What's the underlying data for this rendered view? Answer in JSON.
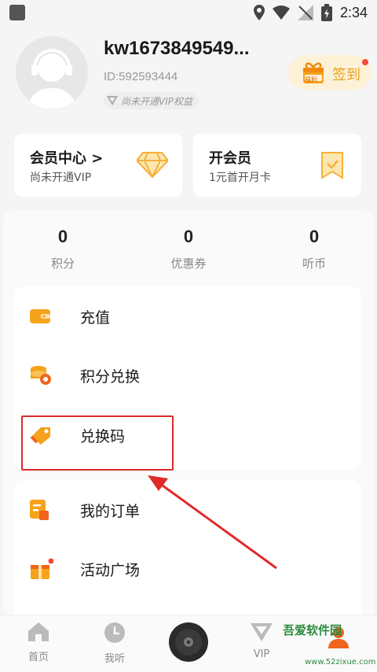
{
  "status_bar": {
    "time": "2:34"
  },
  "profile": {
    "username": "kw1673849549...",
    "user_id": "ID:592593444",
    "vip_status": "尚未开通VIP权益",
    "checkin_label": "签到",
    "checkin_badge": "福利"
  },
  "member_center": {
    "title": "会员中心 >",
    "subtitle": "尚未开通VIP"
  },
  "open_member": {
    "title": "开会员",
    "subtitle": "1元首开月卡"
  },
  "stats": [
    {
      "value": "0",
      "label": "积分"
    },
    {
      "value": "0",
      "label": "优惠券"
    },
    {
      "value": "0",
      "label": "听币"
    }
  ],
  "menu": [
    {
      "label": "充值",
      "icon": "wallet-icon"
    },
    {
      "label": "积分兑换",
      "icon": "coins-icon"
    },
    {
      "label": "兑换码",
      "icon": "tag-icon"
    },
    {
      "label": "我的订单",
      "icon": "order-icon"
    },
    {
      "label": "活动广场",
      "icon": "gift-box-icon"
    }
  ],
  "bottom_nav": [
    {
      "label": "首页",
      "icon": "home-icon"
    },
    {
      "label": "我听",
      "icon": "clock-icon"
    },
    {
      "label": "VIP",
      "icon": "vip-icon"
    }
  ],
  "watermark": {
    "name": "吾爱软件园",
    "url": "www.52zixue.com"
  },
  "colors": {
    "accent": "#f5a623",
    "highlight": "#e02a2a"
  }
}
